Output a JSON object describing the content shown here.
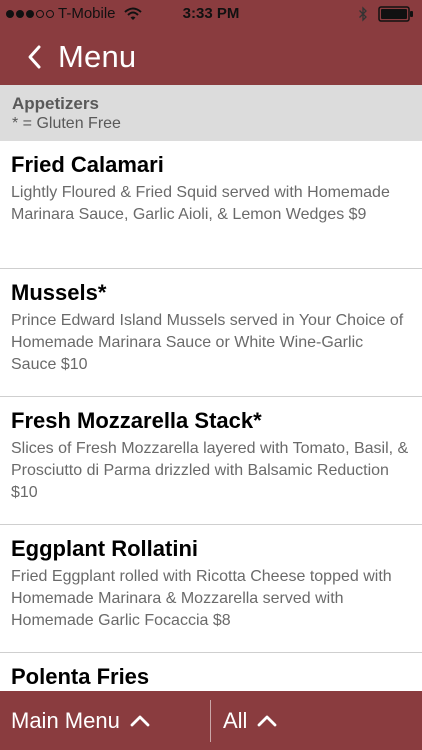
{
  "status_bar": {
    "carrier": "T-Mobile",
    "time": "3:33 PM",
    "signal_dots_filled": 3,
    "signal_dots_total": 5
  },
  "nav": {
    "title": "Menu",
    "back_icon": "chevron-left-icon"
  },
  "section": {
    "title": "Appetizers",
    "note": "* = Gluten Free"
  },
  "items": [
    {
      "name": "Fried Calamari",
      "description": "Lightly Floured & Fried Squid served with Homemade Marinara Sauce, Garlic Aioli, & Lemon Wedges $9"
    },
    {
      "name": "Mussels*",
      "description": "Prince Edward Island Mussels served in Your Choice of Homemade Marinara Sauce or White Wine-Garlic Sauce $10"
    },
    {
      "name": "Fresh Mozzarella Stack*",
      "description": "Slices of Fresh Mozzarella layered with Tomato, Basil, & Prosciutto di Parma drizzled with Balsamic Reduction $10"
    },
    {
      "name": "Eggplant Rollatini",
      "description": "Fried Eggplant rolled with Ricotta Cheese topped with Homemade Marinara & Mozzarella served with Homemade Garlic Focaccia $8"
    },
    {
      "name": "Polenta Fries",
      "description": ""
    }
  ],
  "footer": {
    "main_menu_label": "Main Menu",
    "all_label": "All"
  },
  "colors": {
    "brand": "#8a3c3f",
    "section_bg": "#dcdcdc",
    "description_text": "#6a6a6a"
  }
}
